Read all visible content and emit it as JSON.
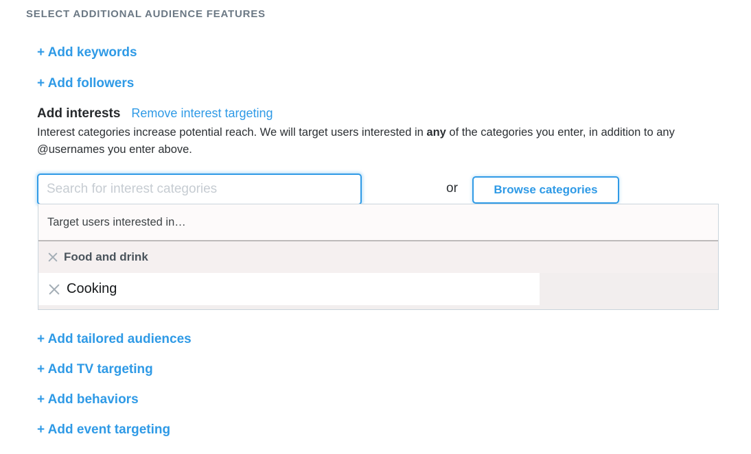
{
  "section": {
    "title": "Select additional audience features"
  },
  "top_links": [
    {
      "label": "+ Add keywords",
      "name": "add-keywords-link"
    },
    {
      "label": "+ Add followers",
      "name": "add-followers-link"
    }
  ],
  "interests": {
    "title": "Add interests",
    "remove_label": "Remove interest targeting",
    "description_part1": "Interest categories increase potential reach. We will target users interested in ",
    "description_bold": "any",
    "description_part2": " of the categories you enter, in addition to any @usernames you enter above.",
    "search": {
      "placeholder": "Search for interest categories",
      "value": ""
    },
    "or_label": "or",
    "browse_label": "Browse categories",
    "panel": {
      "header": "Target users interested in…",
      "category": {
        "label": "Food and drink",
        "remove_icon": "close-x-icon"
      },
      "items": [
        {
          "label": "Cooking",
          "remove_icon": "close-x-icon"
        }
      ]
    }
  },
  "bottom_links": [
    {
      "label": "+ Add tailored audiences",
      "name": "add-tailored-audiences-link"
    },
    {
      "label": "+ Add TV targeting",
      "name": "add-tv-targeting-link"
    },
    {
      "label": "+ Add behaviors",
      "name": "add-behaviors-link"
    },
    {
      "label": "+ Add event targeting",
      "name": "add-event-targeting-link"
    }
  ],
  "colors": {
    "link_blue": "#2f9ae6",
    "heading_grey": "#6b7884",
    "panel_bg": "#f2eeee",
    "panel_border": "#c9d4dc",
    "icon_grey": "#a4aeb6"
  }
}
